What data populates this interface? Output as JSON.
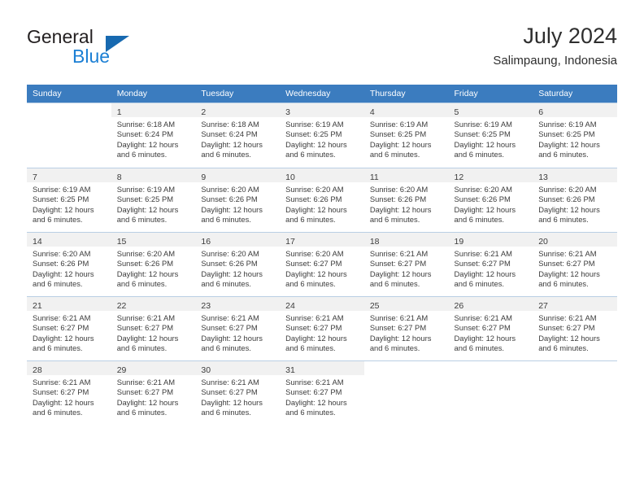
{
  "brand": {
    "name_top": "General",
    "name_bottom": "Blue",
    "triangle_icon": "triangle-icon",
    "accent_color": "#1b7fd4"
  },
  "header": {
    "title": "July 2024",
    "subtitle": "Salimpaung, Indonesia"
  },
  "calendar": {
    "header_bg": "#3b7cbf",
    "weekdays": [
      "Sunday",
      "Monday",
      "Tuesday",
      "Wednesday",
      "Thursday",
      "Friday",
      "Saturday"
    ],
    "weeks": [
      [
        {
          "blank": true
        },
        {
          "day": "1",
          "sunrise": "Sunrise: 6:18 AM",
          "sunset": "Sunset: 6:24 PM",
          "daylight_1": "Daylight: 12 hours",
          "daylight_2": "and 6 minutes."
        },
        {
          "day": "2",
          "sunrise": "Sunrise: 6:18 AM",
          "sunset": "Sunset: 6:24 PM",
          "daylight_1": "Daylight: 12 hours",
          "daylight_2": "and 6 minutes."
        },
        {
          "day": "3",
          "sunrise": "Sunrise: 6:19 AM",
          "sunset": "Sunset: 6:25 PM",
          "daylight_1": "Daylight: 12 hours",
          "daylight_2": "and 6 minutes."
        },
        {
          "day": "4",
          "sunrise": "Sunrise: 6:19 AM",
          "sunset": "Sunset: 6:25 PM",
          "daylight_1": "Daylight: 12 hours",
          "daylight_2": "and 6 minutes."
        },
        {
          "day": "5",
          "sunrise": "Sunrise: 6:19 AM",
          "sunset": "Sunset: 6:25 PM",
          "daylight_1": "Daylight: 12 hours",
          "daylight_2": "and 6 minutes."
        },
        {
          "day": "6",
          "sunrise": "Sunrise: 6:19 AM",
          "sunset": "Sunset: 6:25 PM",
          "daylight_1": "Daylight: 12 hours",
          "daylight_2": "and 6 minutes."
        }
      ],
      [
        {
          "day": "7",
          "sunrise": "Sunrise: 6:19 AM",
          "sunset": "Sunset: 6:25 PM",
          "daylight_1": "Daylight: 12 hours",
          "daylight_2": "and 6 minutes."
        },
        {
          "day": "8",
          "sunrise": "Sunrise: 6:19 AM",
          "sunset": "Sunset: 6:25 PM",
          "daylight_1": "Daylight: 12 hours",
          "daylight_2": "and 6 minutes."
        },
        {
          "day": "9",
          "sunrise": "Sunrise: 6:20 AM",
          "sunset": "Sunset: 6:26 PM",
          "daylight_1": "Daylight: 12 hours",
          "daylight_2": "and 6 minutes."
        },
        {
          "day": "10",
          "sunrise": "Sunrise: 6:20 AM",
          "sunset": "Sunset: 6:26 PM",
          "daylight_1": "Daylight: 12 hours",
          "daylight_2": "and 6 minutes."
        },
        {
          "day": "11",
          "sunrise": "Sunrise: 6:20 AM",
          "sunset": "Sunset: 6:26 PM",
          "daylight_1": "Daylight: 12 hours",
          "daylight_2": "and 6 minutes."
        },
        {
          "day": "12",
          "sunrise": "Sunrise: 6:20 AM",
          "sunset": "Sunset: 6:26 PM",
          "daylight_1": "Daylight: 12 hours",
          "daylight_2": "and 6 minutes."
        },
        {
          "day": "13",
          "sunrise": "Sunrise: 6:20 AM",
          "sunset": "Sunset: 6:26 PM",
          "daylight_1": "Daylight: 12 hours",
          "daylight_2": "and 6 minutes."
        }
      ],
      [
        {
          "day": "14",
          "sunrise": "Sunrise: 6:20 AM",
          "sunset": "Sunset: 6:26 PM",
          "daylight_1": "Daylight: 12 hours",
          "daylight_2": "and 6 minutes."
        },
        {
          "day": "15",
          "sunrise": "Sunrise: 6:20 AM",
          "sunset": "Sunset: 6:26 PM",
          "daylight_1": "Daylight: 12 hours",
          "daylight_2": "and 6 minutes."
        },
        {
          "day": "16",
          "sunrise": "Sunrise: 6:20 AM",
          "sunset": "Sunset: 6:26 PM",
          "daylight_1": "Daylight: 12 hours",
          "daylight_2": "and 6 minutes."
        },
        {
          "day": "17",
          "sunrise": "Sunrise: 6:20 AM",
          "sunset": "Sunset: 6:27 PM",
          "daylight_1": "Daylight: 12 hours",
          "daylight_2": "and 6 minutes."
        },
        {
          "day": "18",
          "sunrise": "Sunrise: 6:21 AM",
          "sunset": "Sunset: 6:27 PM",
          "daylight_1": "Daylight: 12 hours",
          "daylight_2": "and 6 minutes."
        },
        {
          "day": "19",
          "sunrise": "Sunrise: 6:21 AM",
          "sunset": "Sunset: 6:27 PM",
          "daylight_1": "Daylight: 12 hours",
          "daylight_2": "and 6 minutes."
        },
        {
          "day": "20",
          "sunrise": "Sunrise: 6:21 AM",
          "sunset": "Sunset: 6:27 PM",
          "daylight_1": "Daylight: 12 hours",
          "daylight_2": "and 6 minutes."
        }
      ],
      [
        {
          "day": "21",
          "sunrise": "Sunrise: 6:21 AM",
          "sunset": "Sunset: 6:27 PM",
          "daylight_1": "Daylight: 12 hours",
          "daylight_2": "and 6 minutes."
        },
        {
          "day": "22",
          "sunrise": "Sunrise: 6:21 AM",
          "sunset": "Sunset: 6:27 PM",
          "daylight_1": "Daylight: 12 hours",
          "daylight_2": "and 6 minutes."
        },
        {
          "day": "23",
          "sunrise": "Sunrise: 6:21 AM",
          "sunset": "Sunset: 6:27 PM",
          "daylight_1": "Daylight: 12 hours",
          "daylight_2": "and 6 minutes."
        },
        {
          "day": "24",
          "sunrise": "Sunrise: 6:21 AM",
          "sunset": "Sunset: 6:27 PM",
          "daylight_1": "Daylight: 12 hours",
          "daylight_2": "and 6 minutes."
        },
        {
          "day": "25",
          "sunrise": "Sunrise: 6:21 AM",
          "sunset": "Sunset: 6:27 PM",
          "daylight_1": "Daylight: 12 hours",
          "daylight_2": "and 6 minutes."
        },
        {
          "day": "26",
          "sunrise": "Sunrise: 6:21 AM",
          "sunset": "Sunset: 6:27 PM",
          "daylight_1": "Daylight: 12 hours",
          "daylight_2": "and 6 minutes."
        },
        {
          "day": "27",
          "sunrise": "Sunrise: 6:21 AM",
          "sunset": "Sunset: 6:27 PM",
          "daylight_1": "Daylight: 12 hours",
          "daylight_2": "and 6 minutes."
        }
      ],
      [
        {
          "day": "28",
          "sunrise": "Sunrise: 6:21 AM",
          "sunset": "Sunset: 6:27 PM",
          "daylight_1": "Daylight: 12 hours",
          "daylight_2": "and 6 minutes."
        },
        {
          "day": "29",
          "sunrise": "Sunrise: 6:21 AM",
          "sunset": "Sunset: 6:27 PM",
          "daylight_1": "Daylight: 12 hours",
          "daylight_2": "and 6 minutes."
        },
        {
          "day": "30",
          "sunrise": "Sunrise: 6:21 AM",
          "sunset": "Sunset: 6:27 PM",
          "daylight_1": "Daylight: 12 hours",
          "daylight_2": "and 6 minutes."
        },
        {
          "day": "31",
          "sunrise": "Sunrise: 6:21 AM",
          "sunset": "Sunset: 6:27 PM",
          "daylight_1": "Daylight: 12 hours",
          "daylight_2": "and 6 minutes."
        },
        {
          "blank": true
        },
        {
          "blank": true
        },
        {
          "blank": true
        }
      ]
    ]
  }
}
